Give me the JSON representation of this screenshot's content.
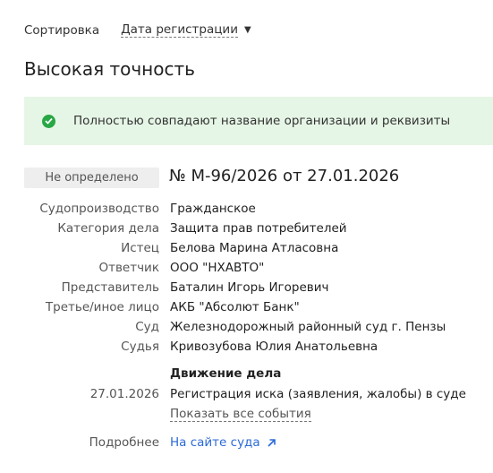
{
  "sort": {
    "label": "Сортировка",
    "selected": "Дата регистрации"
  },
  "section_title": "Высокая точность",
  "banner": {
    "text": "Полностью совпадают название организации и реквизиты",
    "color": "#e6f6e6",
    "icon": "check-circle-icon"
  },
  "case": {
    "status": "Не определено",
    "number": "№ М-96/2026 от 27.01.2026",
    "details": [
      {
        "key": "Судопроизводство",
        "value": "Гражданское"
      },
      {
        "key": "Категория дела",
        "value": "Защита прав потребителей"
      },
      {
        "key": "Истец",
        "value": "Белова Марина Атласовна"
      },
      {
        "key": "Ответчик",
        "value": "ООО \"НХАВТО\""
      },
      {
        "key": "Представитель",
        "value": "Баталин Игорь Игоревич"
      },
      {
        "key": "Третье/иное лицо",
        "value": "АКБ \"Абсолют Банк\""
      },
      {
        "key": "Суд",
        "value": "Железнодорожный районный суд г. Пензы"
      },
      {
        "key": "Судья",
        "value": "Кривозубова Юлия Анатольевна"
      }
    ],
    "movement": {
      "title": "Движение дела",
      "event_date": "27.01.2026",
      "event_text": "Регистрация иска (заявления, жалобы) в суде",
      "show_all": "Показать все события"
    },
    "more": {
      "label": "Подробнее",
      "link": "На сайте суда",
      "link_color": "#2a6ad6"
    }
  }
}
